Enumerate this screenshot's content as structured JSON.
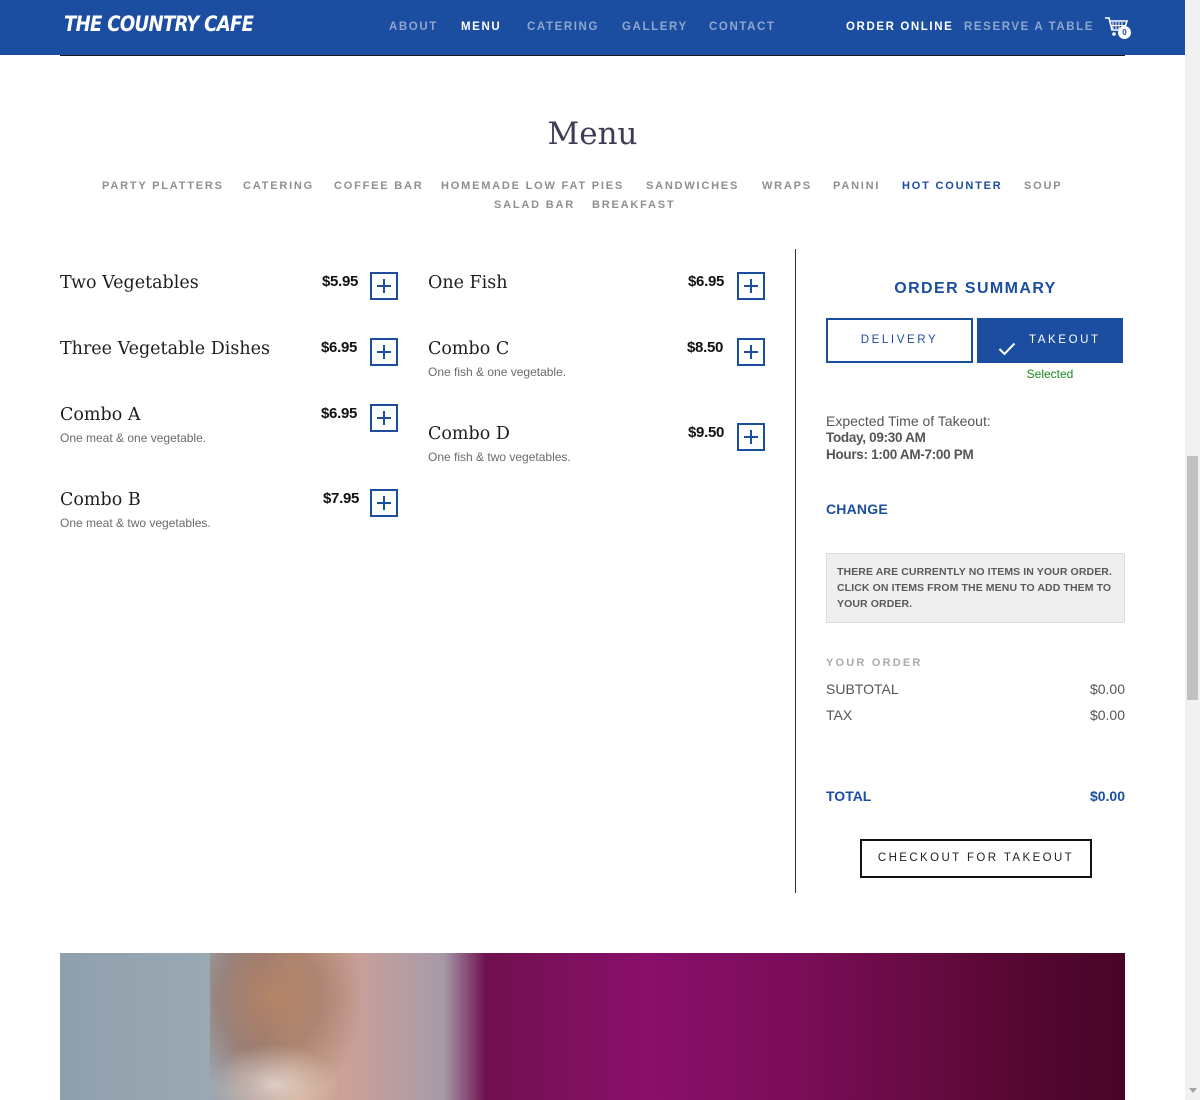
{
  "brand": {
    "logo_text": "THE COUNTRY CAFE"
  },
  "nav": {
    "links": [
      "ABOUT",
      "MENU",
      "CATERING",
      "GALLERY",
      "CONTACT"
    ],
    "order_online": "ORDER ONLINE",
    "reserve": "RESERVE A TABLE",
    "cart_count": "0"
  },
  "menu": {
    "title": "Menu",
    "categories": [
      "PARTY PLATTERS",
      "CATERING",
      "COFFEE BAR",
      "HOMEMADE LOW FAT PIES",
      "SANDWICHES",
      "WRAPS",
      "PANINI",
      "HOT COUNTER",
      "SOUP",
      "SALAD BAR",
      "BREAKFAST"
    ],
    "active_category": "HOT COUNTER",
    "items_left": [
      {
        "name": "Two Vegetables",
        "price": "$5.95",
        "desc": ""
      },
      {
        "name": "Three Vegetable Dishes",
        "price": "$6.95",
        "desc": ""
      },
      {
        "name": "Combo A",
        "price": "$6.95",
        "desc": "One meat & one vegetable."
      },
      {
        "name": "Combo B",
        "price": "$7.95",
        "desc": "One meat & two vegetables."
      }
    ],
    "items_right": [
      {
        "name": "One Fish",
        "price": "$6.95",
        "desc": ""
      },
      {
        "name": "Combo C",
        "price": "$8.50",
        "desc": "One fish & one vegetable."
      },
      {
        "name": "Combo D",
        "price": "$9.50",
        "desc": "One fish & two vegetables."
      }
    ]
  },
  "order_summary": {
    "title": "ORDER SUMMARY",
    "delivery_label": "DELIVERY",
    "takeout_label": "TAKEOUT",
    "selected_text": "Selected",
    "expected_label": "Expected Time of Takeout:",
    "expected_time": "Today, 09:30 AM",
    "hours": "Hours: 1:00 AM-7:00 PM",
    "change_label": "CHANGE",
    "empty_notice": "THERE ARE CURRENTLY NO ITEMS IN YOUR ORDER. CLICK ON ITEMS FROM THE MENU TO ADD THEM TO YOUR ORDER.",
    "your_order_label": "YOUR ORDER",
    "subtotal_label": "SUBTOTAL",
    "subtotal": "$0.00",
    "tax_label": "TAX",
    "tax": "$0.00",
    "total_label": "TOTAL",
    "total": "$0.00",
    "checkout_label": "CHECKOUT FOR TAKEOUT"
  },
  "colors": {
    "brand_blue": "#1b4ea0",
    "selected_green": "#1a8a1a"
  },
  "icons": [
    "cart-icon",
    "check-icon",
    "plus-icon"
  ]
}
